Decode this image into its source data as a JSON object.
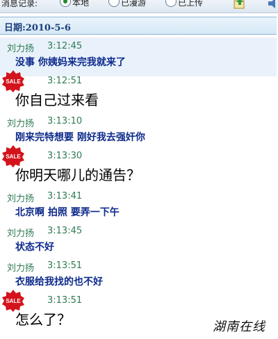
{
  "toolbar": {
    "label": "消息记录:",
    "options": [
      "本地",
      "已漫游",
      "已上传"
    ],
    "selected": 0
  },
  "date_label": "日期:2010-5-6",
  "messages": [
    {
      "sender": "刘力扬",
      "time": "3:12:45",
      "text": "没事 你姨妈来完我就来了",
      "mine": false
    },
    {
      "sender": "",
      "time": "3:12:51",
      "text": "你自己过来看",
      "mine": true
    },
    {
      "sender": "刘力扬",
      "time": "3:13:10",
      "text": "刚来完特想要 刚好我去强奸你",
      "mine": false
    },
    {
      "sender": "",
      "time": "3:13:30",
      "text": "你明天哪儿的通告？",
      "mine": true
    },
    {
      "sender": "刘力扬",
      "time": "3:13:41",
      "text": "北京啊 拍照 要弄一下午",
      "mine": false
    },
    {
      "sender": "刘力扬",
      "time": "3:13:45",
      "text": "状态不好",
      "mine": false
    },
    {
      "sender": "刘力扬",
      "time": "3:13:51",
      "text": "衣服给我找的也不好",
      "mine": false
    },
    {
      "sender": "",
      "time": "3:13:51",
      "text": "怎么了？",
      "mine": true
    }
  ],
  "sale_badge": "SALE",
  "watermark": "湖南在线",
  "colors": {
    "sender": "#2e7a52",
    "incoming_text": "#0d2a8c",
    "outgoing_text": "#000000",
    "date_bar": "#d6e8f6",
    "badge": "#d4141c"
  },
  "icons": [
    "radio-icon",
    "upload-icon",
    "speaker-icon",
    "sale-badge-icon"
  ]
}
